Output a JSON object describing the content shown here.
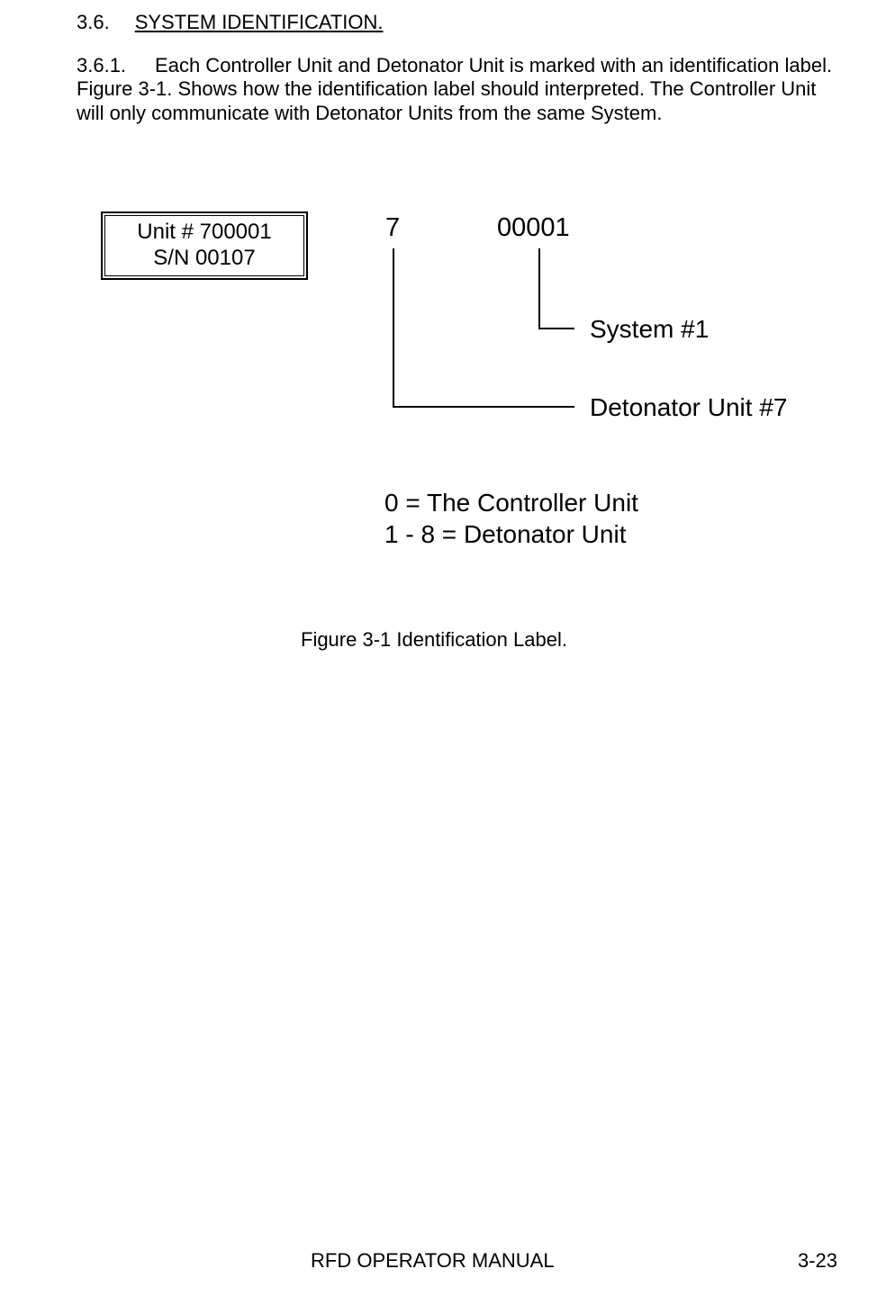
{
  "heading": {
    "number": "3.6.",
    "title": "SYSTEM IDENTIFICATION."
  },
  "paragraph": {
    "number": "3.6.1.",
    "text": "Each Controller Unit and Detonator Unit is marked with an identification label. Figure 3-1.  Shows how the identification label should interpreted.  The Controller Unit will only communicate with Detonator Units from the same System."
  },
  "id_label": {
    "unit_line": "Unit # 700001",
    "sn_line": "S/N 00107"
  },
  "breakdown": {
    "first_digit": "7",
    "rest_digits": "00001"
  },
  "callouts": {
    "system": "System #1",
    "detonator": "Detonator Unit #7"
  },
  "legend": {
    "line0": "0 = The Controller Unit",
    "line1": "1 - 8 = Detonator Unit"
  },
  "figure_caption": "Figure 3-1 Identification Label.",
  "footer": {
    "title": "RFD OPERATOR MANUAL",
    "page": "3-23"
  }
}
